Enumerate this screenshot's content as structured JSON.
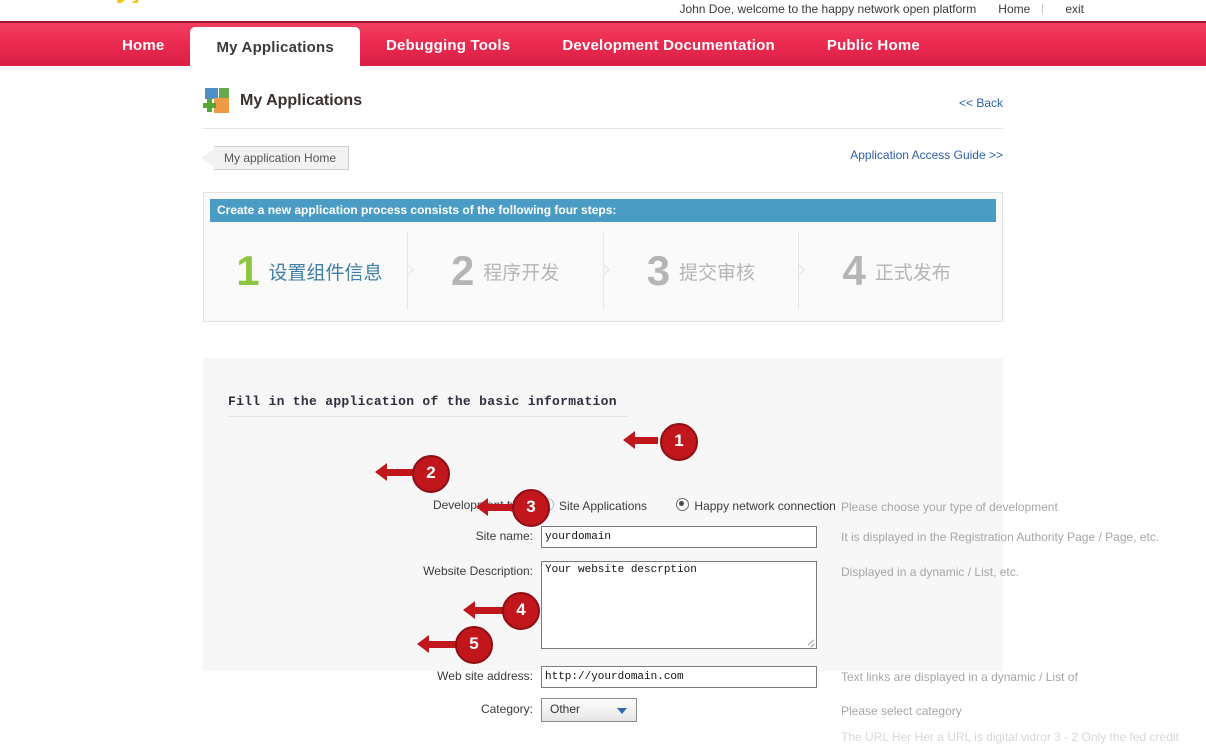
{
  "topbar": {
    "welcome": "John Doe, welcome to the happy network open platform",
    "home": "Home",
    "exit": "exit"
  },
  "nav": {
    "tabs": [
      {
        "label": "Home",
        "active": false
      },
      {
        "label": "My Applications",
        "active": true
      },
      {
        "label": "Debugging Tools",
        "active": false
      },
      {
        "label": "Development Documentation",
        "active": false
      },
      {
        "label": "Public Home",
        "active": false
      }
    ]
  },
  "header": {
    "title": "My Applications",
    "back_link": "<< Back",
    "breadcrumb": "My application Home",
    "guide_link": "Application Access Guide >>"
  },
  "steps": {
    "bar_title": "Create a new application process consists of the following four steps:",
    "items": [
      {
        "num": "1",
        "label": "设置组件信息",
        "active": true
      },
      {
        "num": "2",
        "label": "程序开发",
        "active": false
      },
      {
        "num": "3",
        "label": "提交审核",
        "active": false
      },
      {
        "num": "4",
        "label": "正式发布",
        "active": false
      }
    ]
  },
  "form": {
    "title": "Fill in the application of the basic information",
    "dev_type": {
      "label": "Development type:",
      "options": [
        {
          "label": "Site Applications",
          "checked": false
        },
        {
          "label": "Happy network connection",
          "checked": true
        }
      ],
      "hint": "Please choose your type of development"
    },
    "site_name": {
      "label": "Site name:",
      "value": "yourdomain",
      "hint": "It is displayed in the Registration Authority Page / Page, etc."
    },
    "description": {
      "label": "Website Description:",
      "value": "Your website descrption",
      "hint": "Displayed in a dynamic / List, etc."
    },
    "address": {
      "label": "Web site address:",
      "value": "http://yourdomain.com",
      "hint": "Text links are displayed in a dynamic / List of"
    },
    "category": {
      "label": "Category:",
      "value": "Other",
      "hint": "Please select category",
      "options": [
        "Other"
      ]
    },
    "clipped_hint": "The URL Her Her a URL is digital vidror 3 - 2 Only the fed credit"
  },
  "markers": [
    {
      "n": "1"
    },
    {
      "n": "2"
    },
    {
      "n": "3"
    },
    {
      "n": "4"
    },
    {
      "n": "5"
    }
  ],
  "colors": {
    "nav_accent": "#ec2a50",
    "steps_bar": "#4a9cc4",
    "step_active_num": "#8cc63f",
    "step_active_label": "#3f7fa6",
    "link": "#2b5fa8",
    "marker": "#c0161c"
  }
}
